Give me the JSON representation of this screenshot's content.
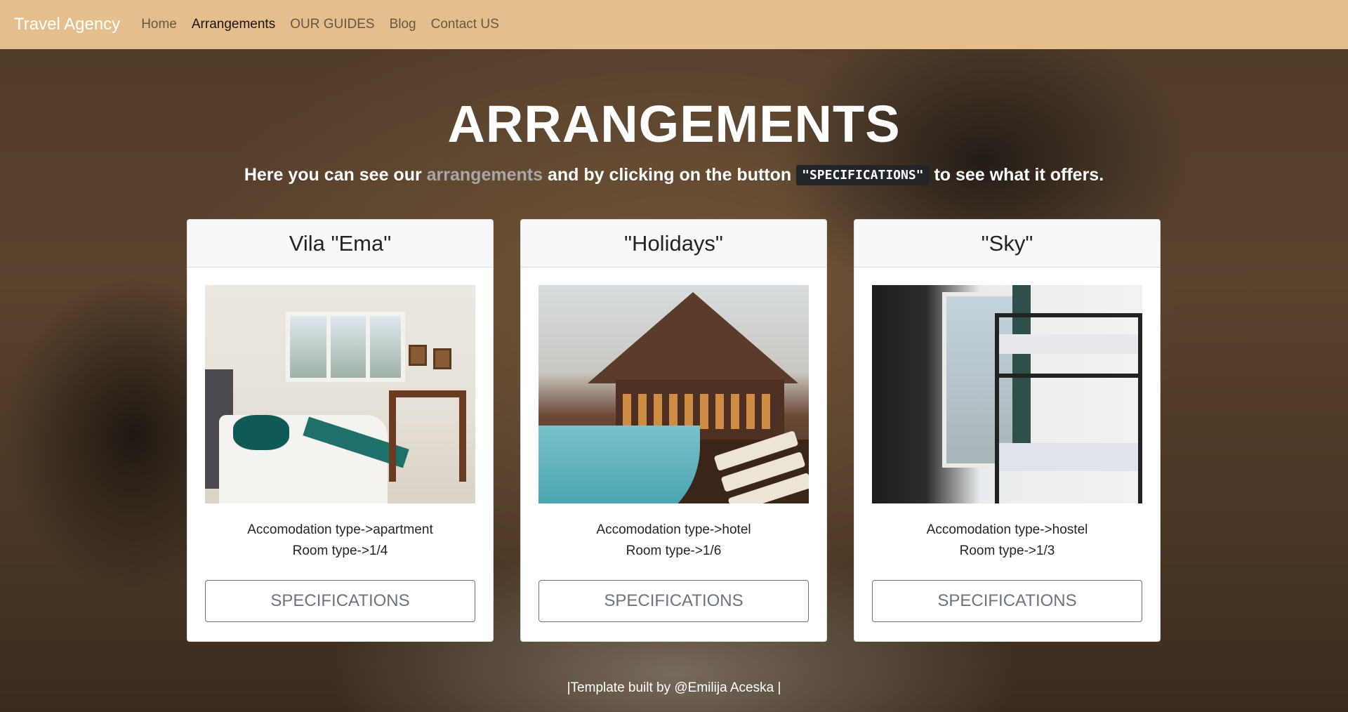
{
  "navbar": {
    "brand": "Travel Agency",
    "links": [
      {
        "label": "Home",
        "active": false
      },
      {
        "label": "Arrangements",
        "active": true
      },
      {
        "label": "OUR GUIDES",
        "active": false
      },
      {
        "label": "Blog",
        "active": false
      },
      {
        "label": "Contact US",
        "active": false
      }
    ],
    "bg_color": "#e4bf8d"
  },
  "hero": {
    "title": "ARRANGEMENTS",
    "subtitle_part1": "Here you can see our ",
    "subtitle_highlight": "arrangements",
    "subtitle_part2": " and by clicking on the button ",
    "subtitle_code": "\"SPECIFICATIONS\"",
    "subtitle_part3": " to see what it offers."
  },
  "cards": [
    {
      "title": "Vila \"Ema\"",
      "image": "bedroom-photo",
      "accommodation": "Accomodation type->apartment",
      "room": "Room type->1/4",
      "button": "SPECIFICATIONS"
    },
    {
      "title": "\"Holidays\"",
      "image": "resort-pool-photo",
      "accommodation": "Accomodation type->hotel",
      "room": "Room type->1/6",
      "button": "SPECIFICATIONS"
    },
    {
      "title": "\"Sky\"",
      "image": "hostel-bunk-photo",
      "accommodation": "Accomodation type->hostel",
      "room": "Room type->1/3",
      "button": "SPECIFICATIONS"
    }
  ],
  "footer": {
    "text": "|Template built by @Emilija Aceska |"
  }
}
